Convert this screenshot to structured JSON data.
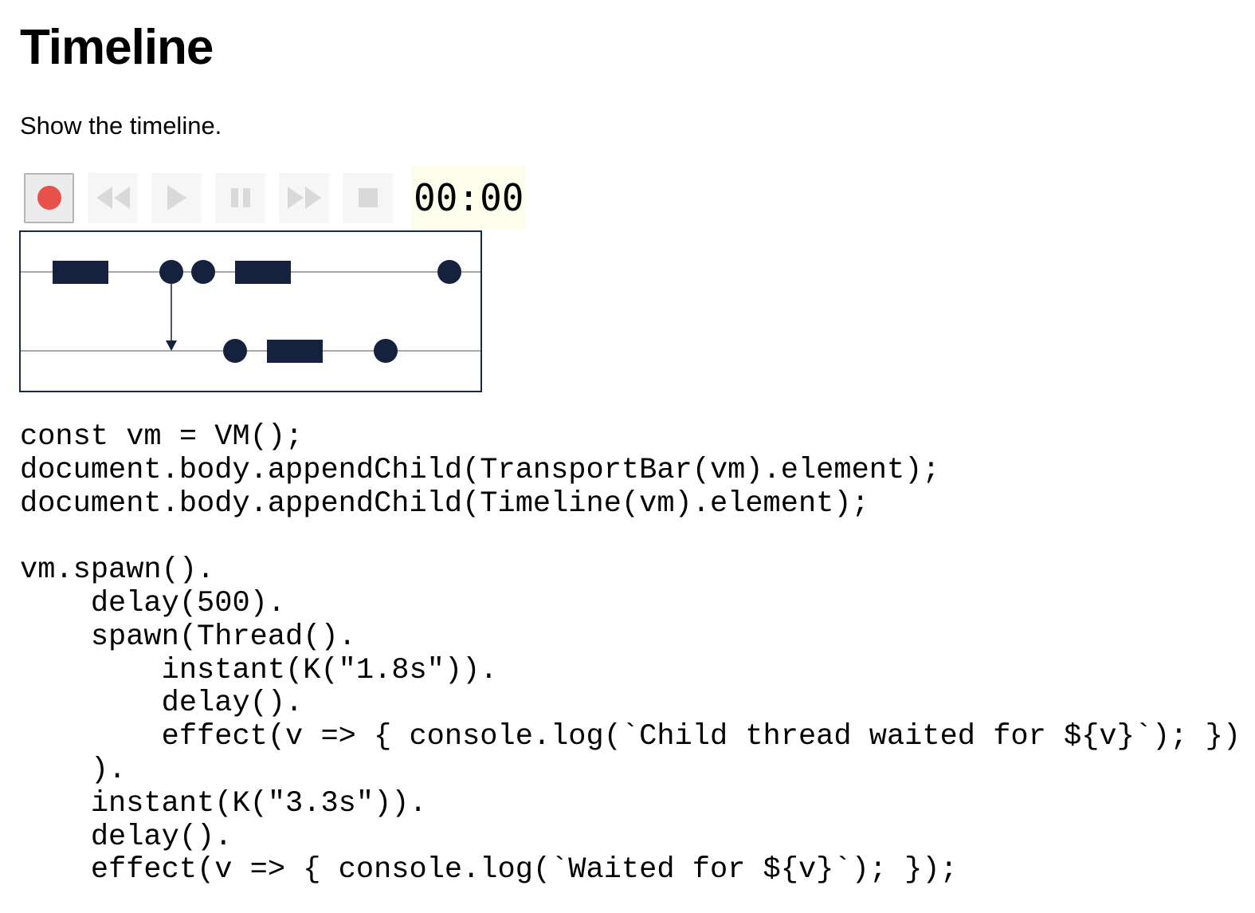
{
  "page": {
    "title": "Timeline",
    "intro": "Show the timeline."
  },
  "transport": {
    "buttons": [
      {
        "name": "record-button",
        "icon": "record-icon",
        "enabled": true,
        "color": "#e8514a"
      },
      {
        "name": "rewind-button",
        "icon": "rewind-icon",
        "enabled": false
      },
      {
        "name": "play-button",
        "icon": "play-icon",
        "enabled": false
      },
      {
        "name": "pause-button",
        "icon": "pause-icon",
        "enabled": false
      },
      {
        "name": "fast-forward-button",
        "icon": "fast-forward-icon",
        "enabled": false
      },
      {
        "name": "stop-button",
        "icon": "stop-icon",
        "enabled": false
      }
    ],
    "clock": "00:00",
    "clock_background": "#fcfdea",
    "disabled_icon_color": "#d9d9d9"
  },
  "timeline": {
    "mark_color": "#16213d",
    "line_color": "#8a8a8a",
    "tracks": [
      {
        "name": "main-thread",
        "events": [
          "delay",
          "instant",
          "instant",
          "delay",
          "effect"
        ]
      },
      {
        "name": "child-thread",
        "events": [
          "instant",
          "delay",
          "effect"
        ]
      }
    ],
    "spawn_arrow": "main-thread to child-thread"
  },
  "code": {
    "lines": [
      "const vm = VM();",
      "document.body.appendChild(TransportBar(vm).element);",
      "document.body.appendChild(Timeline(vm).element);",
      "",
      "vm.spawn().",
      "    delay(500).",
      "    spawn(Thread().",
      "        instant(K(\"1.8s\")).",
      "        delay().",
      "        effect(v => { console.log(`Child thread waited for ${v}`); })",
      "    ).",
      "    instant(K(\"3.3s\")).",
      "    delay().",
      "    effect(v => { console.log(`Waited for ${v}`); });"
    ]
  }
}
